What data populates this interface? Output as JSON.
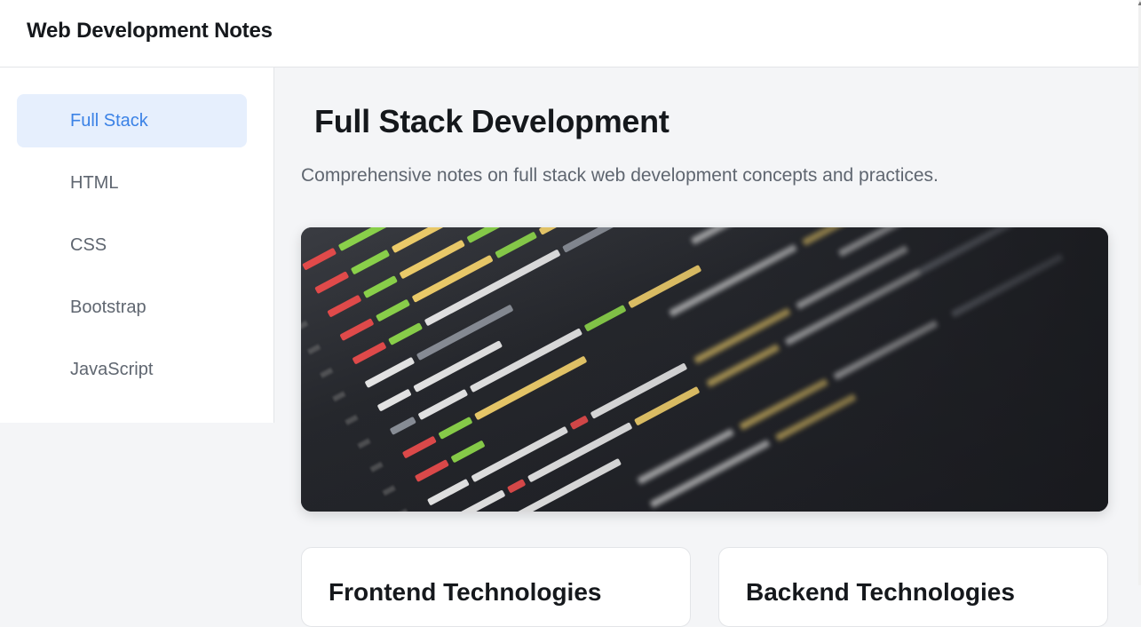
{
  "header": {
    "title": "Web Development Notes"
  },
  "sidebar": {
    "items": [
      {
        "label": "Full Stack",
        "active": true
      },
      {
        "label": "HTML",
        "active": false
      },
      {
        "label": "CSS",
        "active": false
      },
      {
        "label": "Bootstrap",
        "active": false
      },
      {
        "label": "JavaScript",
        "active": false
      }
    ]
  },
  "main": {
    "title": "Full Stack Development",
    "description": "Comprehensive notes on full stack web development concepts and practices.",
    "hero_image": "code-editor-photo",
    "cards": [
      {
        "title": "Frontend Technologies"
      },
      {
        "title": "Backend Technologies"
      }
    ]
  },
  "colors": {
    "accent": "#3b82e6",
    "active_bg": "#e6effd",
    "page_bg": "#f4f5f7"
  }
}
